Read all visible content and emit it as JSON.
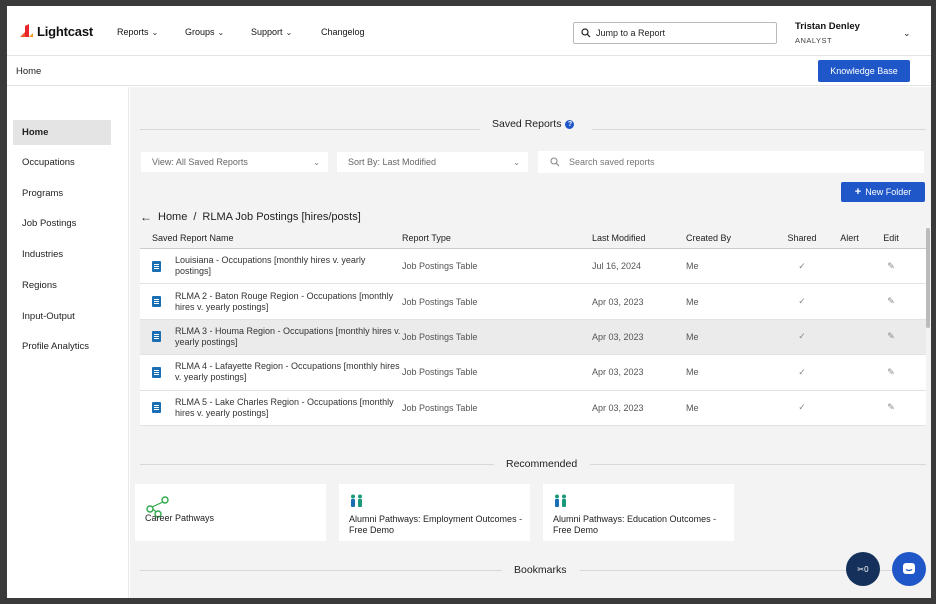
{
  "brand": {
    "name": "Lightcast",
    "accent": "#1f57c8"
  },
  "nav": {
    "items": [
      "Reports",
      "Groups",
      "Support",
      "Changelog"
    ],
    "jump_placeholder": "Jump to a Report",
    "user_name": "Tristan Denley",
    "user_role": "ANALYST"
  },
  "breadcrumb": {
    "home": "Home",
    "kb_button": "Knowledge Base"
  },
  "sidebar": {
    "items": [
      {
        "label": "Home",
        "active": true
      },
      {
        "label": "Occupations"
      },
      {
        "label": "Programs"
      },
      {
        "label": "Job Postings"
      },
      {
        "label": "Industries"
      },
      {
        "label": "Regions"
      },
      {
        "label": "Input-Output"
      },
      {
        "label": "Profile Analytics"
      }
    ]
  },
  "saved": {
    "title": "Saved Reports",
    "view_filter": "View: All Saved Reports",
    "sort_filter": "Sort By: Last Modified",
    "search_placeholder": "Search saved reports",
    "new_folder": "New Folder",
    "path_home": "Home",
    "path_sep": "/",
    "path_folder": "RLMA Job Postings [hires/posts]",
    "columns": [
      "Saved Report Name",
      "Report Type",
      "Last Modified",
      "Created By",
      "Shared",
      "Alert",
      "Edit"
    ],
    "rows": [
      {
        "name": "Louisiana - Occupations [monthly hires v. yearly postings]",
        "type": "Job Postings Table",
        "modified": "Jul 16, 2024",
        "by": "Me"
      },
      {
        "name": "RLMA 2 - Baton Rouge Region - Occupations [monthly hires v. yearly postings]",
        "type": "Job Postings Table",
        "modified": "Apr 03, 2023",
        "by": "Me"
      },
      {
        "name": "RLMA 3 - Houma Region - Occupations [monthly hires v. yearly postings]",
        "type": "Job Postings Table",
        "modified": "Apr 03, 2023",
        "by": "Me"
      },
      {
        "name": "RLMA 4 - Lafayette Region - Occupations [monthly hires v. yearly postings]",
        "type": "Job Postings Table",
        "modified": "Apr 03, 2023",
        "by": "Me"
      },
      {
        "name": "RLMA 5 - Lake Charles Region - Occupations [monthly hires v. yearly postings]",
        "type": "Job Postings Table",
        "modified": "Apr 03, 2023",
        "by": "Me"
      }
    ]
  },
  "recommended": {
    "title": "Recommended",
    "cards": [
      "Career Pathways",
      "Alumni Pathways: Employment Outcomes - Free Demo",
      "Alumni Pathways: Education Outcomes - Free Demo"
    ]
  },
  "bookmarks": {
    "title": "Bookmarks"
  },
  "fab": {
    "count": "0"
  }
}
